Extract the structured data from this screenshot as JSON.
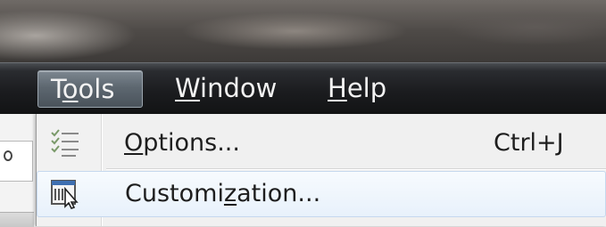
{
  "menubar": {
    "tools": {
      "pre": "T",
      "accel": "o",
      "post": "ols"
    },
    "window": {
      "pre": "",
      "accel": "W",
      "post": "indow"
    },
    "help": {
      "pre": "",
      "accel": "H",
      "post": "elp"
    }
  },
  "dropdown": {
    "options": {
      "pre": "",
      "accel": "O",
      "post": "ptions...",
      "shortcut": "Ctrl+J",
      "icon": "options-checklist-icon"
    },
    "customization": {
      "pre": "Customi",
      "accel": "z",
      "post": "ation...",
      "icon": "customization-icon"
    }
  },
  "colors": {
    "menubar_bg": "#1b1c1f",
    "menu_text": "#f2f2f2",
    "tools_highlight": "#5d6770",
    "dropdown_bg": "#f0f0f0",
    "hover_border": "#c5d8ee"
  }
}
